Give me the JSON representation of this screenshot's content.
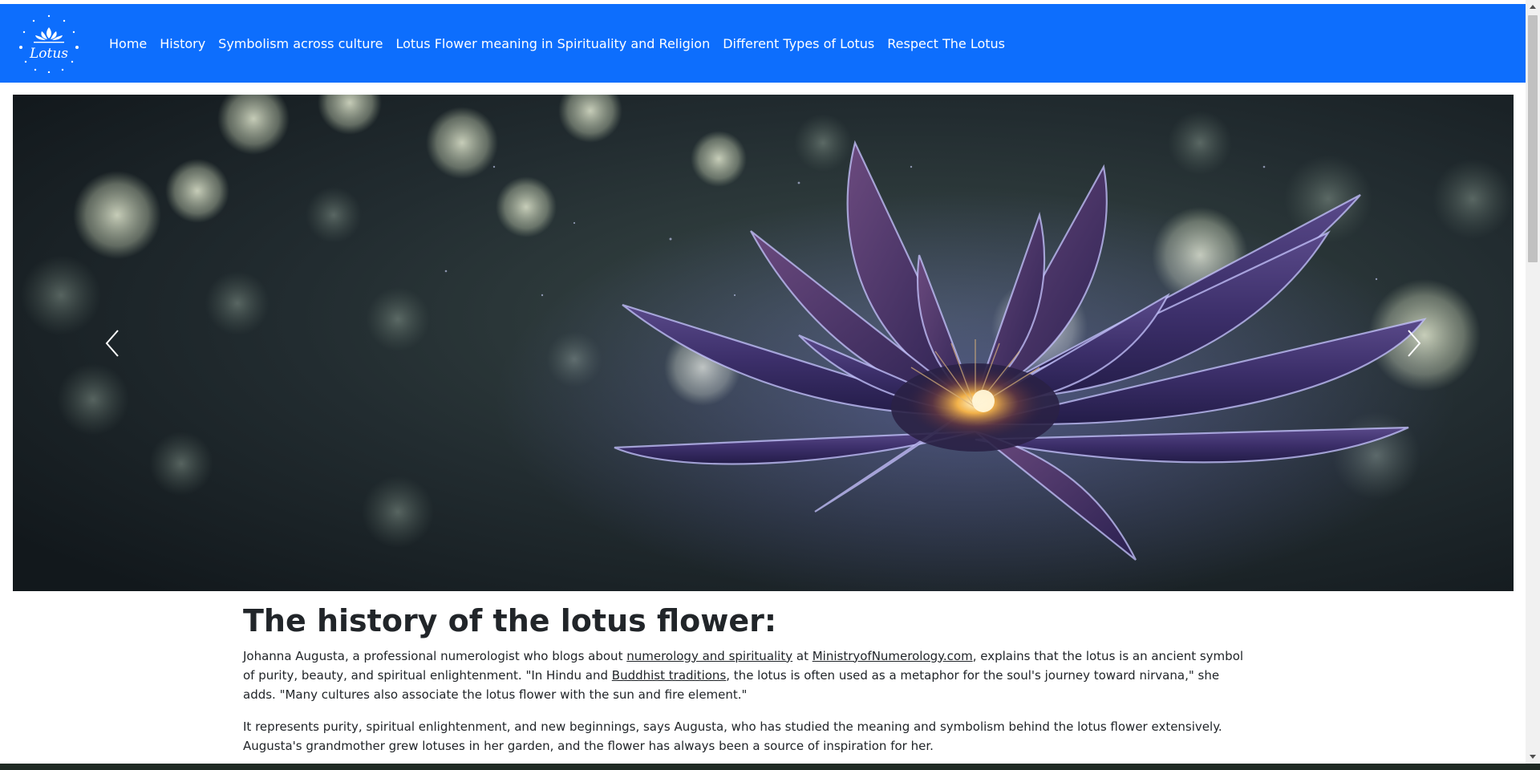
{
  "navbar": {
    "brand_text": "Lotus",
    "links": [
      "Home",
      "History",
      "Symbolism across culture",
      "Lotus Flower meaning in Spirituality and Religion",
      "Different Types of Lotus",
      "Respect The Lotus"
    ],
    "background": "#0d6efd"
  },
  "carousel": {
    "prev_icon": "chevron-left-icon",
    "next_icon": "chevron-right-icon"
  },
  "article": {
    "title": "The history of the lotus flower:",
    "p1_a": "Johanna Augusta, a professional numerologist who blogs about ",
    "p1_link1": "numerology and spirituality",
    "p1_b": " at ",
    "p1_link2": "MinistryofNumerology.com",
    "p1_c": ", explains that the lotus is an ancient symbol of purity, beauty, and spiritual enlightenment. \"In Hindu and ",
    "p1_link3": "Buddhist traditions",
    "p1_d": ", the lotus is often used as a metaphor for the soul's journey toward nirvana,\" she adds. \"Many cultures also associate the lotus flower with the sun and fire element.\"",
    "p2": "It represents purity, spiritual enlightenment, and new beginnings, says Augusta, who has studied the meaning and symbolism behind the lotus flower extensively. Augusta's grandmother grew lotuses in her garden, and the flower has always been a source of inspiration for her."
  }
}
